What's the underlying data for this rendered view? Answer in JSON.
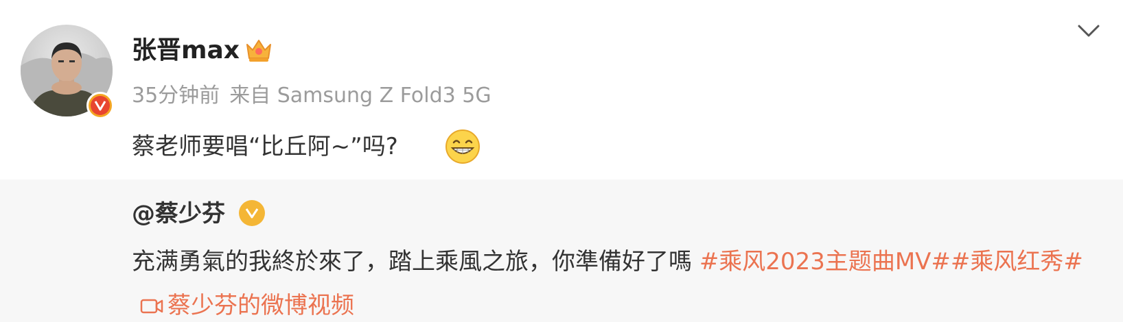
{
  "post": {
    "author": "张晋max",
    "time": "35分钟前",
    "source": "来自 Samsung Z Fold3 5G",
    "text": "蔡老师要唱“比丘阿~”吗?"
  },
  "repost": {
    "author": "@蔡少芬",
    "text": "充满勇氣的我終於來了，踏上乘風之旅，你準備好了嗎 ",
    "tags": [
      "#乘风2023主题曲MV#",
      "#乘风红秀#"
    ],
    "video_label": "蔡少芬的微博视频"
  },
  "icons": {
    "crown": "member-crown-icon",
    "verified_red": "verified-badge-icon",
    "verified_yellow": "verified-badge-icon",
    "emoji": "grin-emoji-icon",
    "chevron": "chevron-down-icon",
    "video": "video-camera-icon"
  },
  "colors": {
    "link": "#eb7350",
    "meta": "#9b9b9b",
    "repost_bg": "#f7f7f7",
    "verified_yellow": "#f4b636",
    "verified_red": "#e8452f"
  }
}
